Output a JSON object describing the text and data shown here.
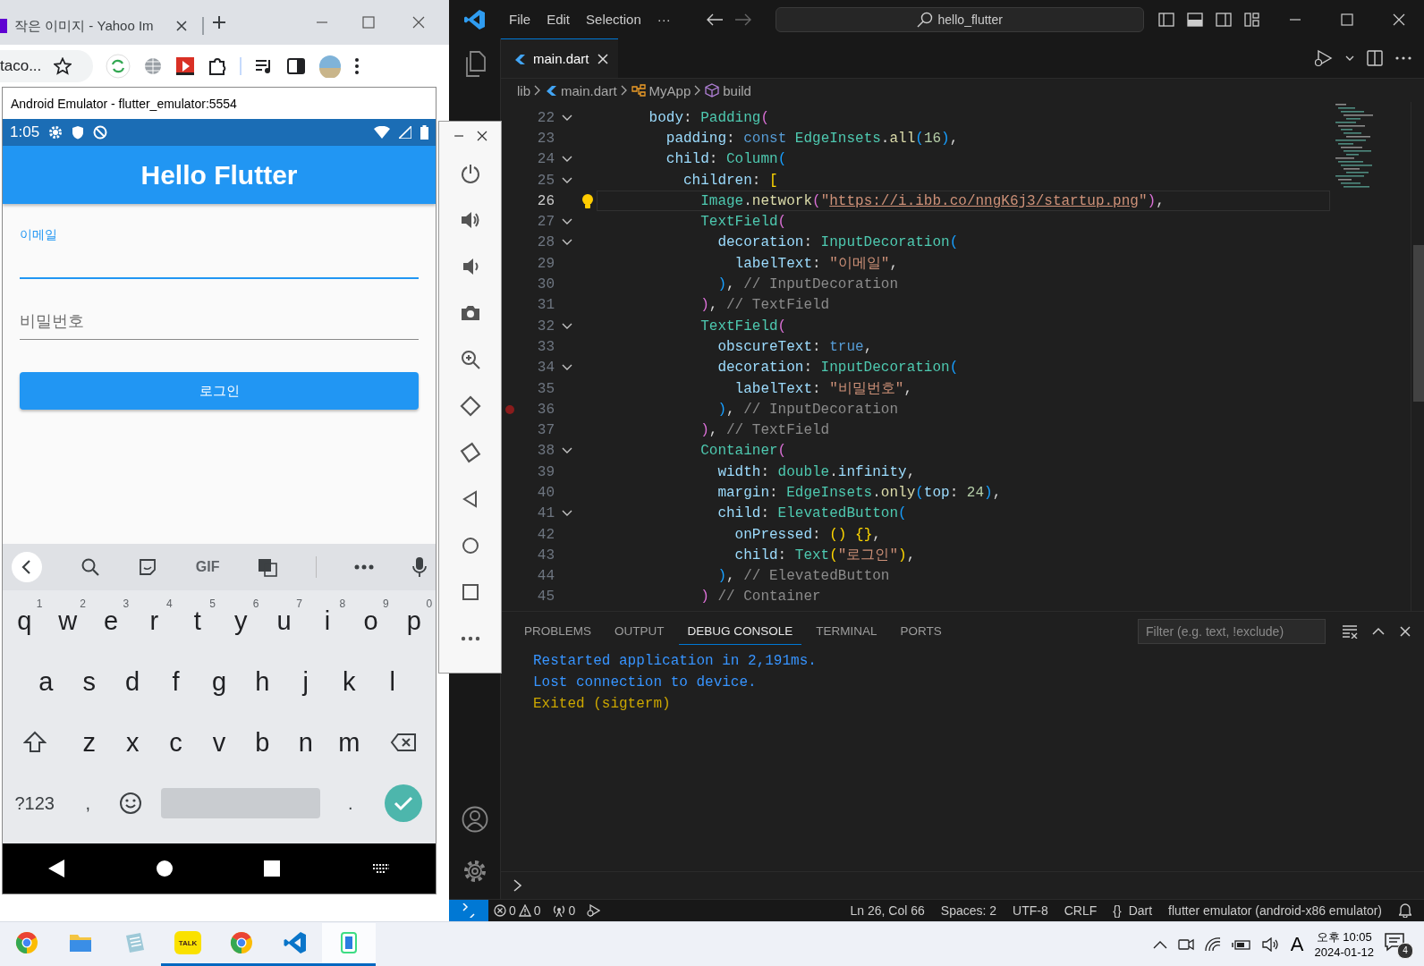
{
  "browser": {
    "tab_title": "작은 이미지 - Yahoo Im",
    "address": "taco..."
  },
  "emulator": {
    "title": "Android Emulator - flutter_emulator:5554",
    "status_time": "1:05",
    "app_title": "Hello Flutter",
    "fields": [
      {
        "label": "이메일",
        "focused": true
      },
      {
        "label": "비밀번호",
        "focused": false
      }
    ],
    "button": "로그인",
    "keyboard": {
      "gif": "GIF",
      "rows": [
        [
          {
            "key": "q",
            "hint": "1"
          },
          {
            "key": "w",
            "hint": "2"
          },
          {
            "key": "e",
            "hint": "3"
          },
          {
            "key": "r",
            "hint": "4"
          },
          {
            "key": "t",
            "hint": "5"
          },
          {
            "key": "y",
            "hint": "6"
          },
          {
            "key": "u",
            "hint": "7"
          },
          {
            "key": "i",
            "hint": "8"
          },
          {
            "key": "o",
            "hint": "9"
          },
          {
            "key": "p",
            "hint": "0"
          }
        ],
        [
          {
            "key": "a"
          },
          {
            "key": "s"
          },
          {
            "key": "d"
          },
          {
            "key": "f"
          },
          {
            "key": "g"
          },
          {
            "key": "h"
          },
          {
            "key": "j"
          },
          {
            "key": "k"
          },
          {
            "key": "l"
          }
        ],
        [
          {
            "key": "z"
          },
          {
            "key": "x"
          },
          {
            "key": "c"
          },
          {
            "key": "v"
          },
          {
            "key": "b"
          },
          {
            "key": "n"
          },
          {
            "key": "m"
          }
        ]
      ],
      "symbols": "?123",
      "comma": ",",
      "period": "."
    }
  },
  "vscode": {
    "menus": [
      "File",
      "Edit",
      "Selection",
      "···"
    ],
    "command_center": "hello_flutter",
    "tabs": [
      {
        "label": "main.dart",
        "selected": true
      }
    ],
    "breadcrumbs": [
      {
        "kind": "folder",
        "label": "lib"
      },
      {
        "kind": "file",
        "label": "main.dart"
      },
      {
        "kind": "class",
        "label": "MyApp"
      },
      {
        "kind": "method",
        "label": "build"
      }
    ],
    "lines": [
      {
        "number": "22",
        "fold": true,
        "current": false,
        "breakpoint": false,
        "lightbulb": false,
        "tokens": [
          {
            "kind": "prop",
            "text": "body"
          },
          {
            "kind": "punct",
            "text": ": "
          },
          {
            "kind": "type",
            "text": "Padding"
          },
          {
            "kind": "b2",
            "text": "("
          }
        ]
      },
      {
        "number": "23",
        "fold": false,
        "current": false,
        "breakpoint": false,
        "lightbulb": false,
        "tokens": [
          {
            "kind": "prop",
            "text": "padding"
          },
          {
            "kind": "punct",
            "text": ": "
          },
          {
            "kind": "keyword",
            "text": "const "
          },
          {
            "kind": "type",
            "text": "EdgeInsets"
          },
          {
            "kind": "punct",
            "text": "."
          },
          {
            "kind": "method",
            "text": "all"
          },
          {
            "kind": "b3",
            "text": "("
          },
          {
            "kind": "number",
            "text": "16"
          },
          {
            "kind": "b3",
            "text": ")"
          },
          {
            "kind": "punct",
            "text": ","
          }
        ]
      },
      {
        "number": "24",
        "fold": true,
        "current": false,
        "breakpoint": false,
        "lightbulb": false,
        "tokens": [
          {
            "kind": "prop",
            "text": "child"
          },
          {
            "kind": "punct",
            "text": ": "
          },
          {
            "kind": "type",
            "text": "Column"
          },
          {
            "kind": "b3",
            "text": "("
          }
        ]
      },
      {
        "number": "25",
        "fold": true,
        "current": false,
        "breakpoint": false,
        "lightbulb": false,
        "tokens": [
          {
            "kind": "prop",
            "text": "children"
          },
          {
            "kind": "punct",
            "text": ": "
          },
          {
            "kind": "b1",
            "text": "["
          }
        ]
      },
      {
        "number": "26",
        "fold": false,
        "current": true,
        "breakpoint": false,
        "lightbulb": true,
        "tokens": [
          {
            "kind": "type",
            "text": "Image"
          },
          {
            "kind": "punct",
            "text": "."
          },
          {
            "kind": "method",
            "text": "network"
          },
          {
            "kind": "b2",
            "text": "("
          },
          {
            "kind": "string",
            "text": "\""
          },
          {
            "kind": "link",
            "text": "https://i.ibb.co/nngK6j3/startup.png"
          },
          {
            "kind": "string",
            "text": "\""
          },
          {
            "kind": "b2",
            "text": ")"
          },
          {
            "kind": "punct",
            "text": ","
          }
        ]
      },
      {
        "number": "27",
        "fold": true,
        "current": false,
        "breakpoint": false,
        "lightbulb": false,
        "tokens": [
          {
            "kind": "type",
            "text": "TextField"
          },
          {
            "kind": "b2",
            "text": "("
          }
        ]
      },
      {
        "number": "28",
        "fold": true,
        "current": false,
        "breakpoint": false,
        "lightbulb": false,
        "tokens": [
          {
            "kind": "prop",
            "text": "decoration"
          },
          {
            "kind": "punct",
            "text": ": "
          },
          {
            "kind": "type",
            "text": "InputDecoration"
          },
          {
            "kind": "b3",
            "text": "("
          }
        ]
      },
      {
        "number": "29",
        "fold": false,
        "current": false,
        "breakpoint": false,
        "lightbulb": false,
        "tokens": [
          {
            "kind": "prop",
            "text": "labelText"
          },
          {
            "kind": "punct",
            "text": ": "
          },
          {
            "kind": "string",
            "text": "\"이메일\""
          },
          {
            "kind": "punct",
            "text": ","
          }
        ]
      },
      {
        "number": "30",
        "fold": false,
        "current": false,
        "breakpoint": false,
        "lightbulb": false,
        "tokens": [
          {
            "kind": "b3",
            "text": ")"
          },
          {
            "kind": "punct",
            "text": ", "
          },
          {
            "kind": "comment",
            "text": "// InputDecoration"
          }
        ]
      },
      {
        "number": "31",
        "fold": false,
        "current": false,
        "breakpoint": false,
        "lightbulb": false,
        "tokens": [
          {
            "kind": "b2",
            "text": ")"
          },
          {
            "kind": "punct",
            "text": ", "
          },
          {
            "kind": "comment",
            "text": "// TextField"
          }
        ]
      },
      {
        "number": "32",
        "fold": true,
        "current": false,
        "breakpoint": false,
        "lightbulb": false,
        "tokens": [
          {
            "kind": "type",
            "text": "TextField"
          },
          {
            "kind": "b2",
            "text": "("
          }
        ]
      },
      {
        "number": "33",
        "fold": false,
        "current": false,
        "breakpoint": false,
        "lightbulb": false,
        "tokens": [
          {
            "kind": "prop",
            "text": "obscureText"
          },
          {
            "kind": "punct",
            "text": ": "
          },
          {
            "kind": "keyword",
            "text": "true"
          },
          {
            "kind": "punct",
            "text": ","
          }
        ]
      },
      {
        "number": "34",
        "fold": true,
        "current": false,
        "breakpoint": false,
        "lightbulb": false,
        "tokens": [
          {
            "kind": "prop",
            "text": "decoration"
          },
          {
            "kind": "punct",
            "text": ": "
          },
          {
            "kind": "type",
            "text": "InputDecoration"
          },
          {
            "kind": "b3",
            "text": "("
          }
        ]
      },
      {
        "number": "35",
        "fold": false,
        "current": false,
        "breakpoint": false,
        "lightbulb": false,
        "tokens": [
          {
            "kind": "prop",
            "text": "labelText"
          },
          {
            "kind": "punct",
            "text": ": "
          },
          {
            "kind": "string",
            "text": "\"비밀번호\""
          },
          {
            "kind": "punct",
            "text": ","
          }
        ]
      },
      {
        "number": "36",
        "fold": false,
        "current": false,
        "breakpoint": true,
        "lightbulb": false,
        "tokens": [
          {
            "kind": "b3",
            "text": ")"
          },
          {
            "kind": "punct",
            "text": ", "
          },
          {
            "kind": "comment",
            "text": "// InputDecoration"
          }
        ]
      },
      {
        "number": "37",
        "fold": false,
        "current": false,
        "breakpoint": false,
        "lightbulb": false,
        "tokens": [
          {
            "kind": "b2",
            "text": ")"
          },
          {
            "kind": "punct",
            "text": ", "
          },
          {
            "kind": "comment",
            "text": "// TextField"
          }
        ]
      },
      {
        "number": "38",
        "fold": true,
        "current": false,
        "breakpoint": false,
        "lightbulb": false,
        "tokens": [
          {
            "kind": "type",
            "text": "Container"
          },
          {
            "kind": "b2",
            "text": "("
          }
        ]
      },
      {
        "number": "39",
        "fold": false,
        "current": false,
        "breakpoint": false,
        "lightbulb": false,
        "tokens": [
          {
            "kind": "prop",
            "text": "width"
          },
          {
            "kind": "punct",
            "text": ": "
          },
          {
            "kind": "type",
            "text": "double"
          },
          {
            "kind": "punct",
            "text": "."
          },
          {
            "kind": "prop",
            "text": "infinity"
          },
          {
            "kind": "punct",
            "text": ","
          }
        ]
      },
      {
        "number": "40",
        "fold": false,
        "current": false,
        "breakpoint": false,
        "lightbulb": false,
        "tokens": [
          {
            "kind": "prop",
            "text": "margin"
          },
          {
            "kind": "punct",
            "text": ": "
          },
          {
            "kind": "type",
            "text": "EdgeInsets"
          },
          {
            "kind": "punct",
            "text": "."
          },
          {
            "kind": "method",
            "text": "only"
          },
          {
            "kind": "b3",
            "text": "("
          },
          {
            "kind": "prop",
            "text": "top"
          },
          {
            "kind": "punct",
            "text": ": "
          },
          {
            "kind": "number",
            "text": "24"
          },
          {
            "kind": "b3",
            "text": ")"
          },
          {
            "kind": "punct",
            "text": ","
          }
        ]
      },
      {
        "number": "41",
        "fold": true,
        "current": false,
        "breakpoint": false,
        "lightbulb": false,
        "tokens": [
          {
            "kind": "prop",
            "text": "child"
          },
          {
            "kind": "punct",
            "text": ": "
          },
          {
            "kind": "type",
            "text": "ElevatedButton"
          },
          {
            "kind": "b3",
            "text": "("
          }
        ]
      },
      {
        "number": "42",
        "fold": false,
        "current": false,
        "breakpoint": false,
        "lightbulb": false,
        "tokens": [
          {
            "kind": "prop",
            "text": "onPressed"
          },
          {
            "kind": "punct",
            "text": ": "
          },
          {
            "kind": "b1",
            "text": "() {}"
          },
          {
            "kind": "punct",
            "text": ","
          }
        ]
      },
      {
        "number": "43",
        "fold": false,
        "current": false,
        "breakpoint": false,
        "lightbulb": false,
        "tokens": [
          {
            "kind": "prop",
            "text": "child"
          },
          {
            "kind": "punct",
            "text": ": "
          },
          {
            "kind": "type",
            "text": "Text"
          },
          {
            "kind": "b1",
            "text": "("
          },
          {
            "kind": "string",
            "text": "\"로그인\""
          },
          {
            "kind": "b1",
            "text": ")"
          },
          {
            "kind": "punct",
            "text": ","
          }
        ]
      },
      {
        "number": "44",
        "fold": false,
        "current": false,
        "breakpoint": false,
        "lightbulb": false,
        "tokens": [
          {
            "kind": "b3",
            "text": ")"
          },
          {
            "kind": "punct",
            "text": ", "
          },
          {
            "kind": "comment",
            "text": "// ElevatedButton"
          }
        ]
      },
      {
        "number": "45",
        "fold": false,
        "current": false,
        "breakpoint": false,
        "lightbulb": false,
        "tokens": [
          {
            "kind": "b2",
            "text": ")"
          },
          {
            "kind": "comment",
            "text": " // Container"
          }
        ]
      }
    ],
    "panel": {
      "tabs": [
        {
          "label": "PROBLEMS",
          "selected": false
        },
        {
          "label": "OUTPUT",
          "selected": false
        },
        {
          "label": "DEBUG CONSOLE",
          "selected": true
        },
        {
          "label": "TERMINAL",
          "selected": false
        },
        {
          "label": "PORTS",
          "selected": false
        }
      ],
      "filter": {
        "placeholder": "Filter (e.g. text, !exclude)"
      },
      "console": [
        {
          "kind": "info",
          "text": "Restarted application in 2,191ms."
        },
        {
          "kind": "info",
          "text": "Lost connection to device."
        },
        {
          "kind": "warning",
          "text": "Exited (sigterm)"
        }
      ]
    },
    "status_bar": {
      "errors": "0",
      "warnings": "0",
      "ports": "0",
      "items": [
        "Ln 26, Col 66",
        "Spaces: 2",
        "UTF-8",
        "CRLF"
      ],
      "language_icon": "{}",
      "language": "Dart",
      "device": "flutter emulator (android-x86 emulator)"
    }
  },
  "taskbar": {
    "apps": [
      {
        "kind": "browser",
        "running": false,
        "selected": false
      },
      {
        "kind": "folder",
        "running": false,
        "selected": false
      },
      {
        "kind": "notepad",
        "running": false,
        "selected": false
      },
      {
        "kind": "chat",
        "label": "TALK",
        "running": true,
        "selected": false
      },
      {
        "kind": "browser",
        "running": true,
        "selected": false
      },
      {
        "kind": "editor",
        "running": true,
        "selected": false
      },
      {
        "kind": "phone",
        "running": true,
        "selected": true
      }
    ],
    "ime": "A",
    "time": "오후 10:05",
    "date": "2024-01-12",
    "notifications": "4"
  }
}
